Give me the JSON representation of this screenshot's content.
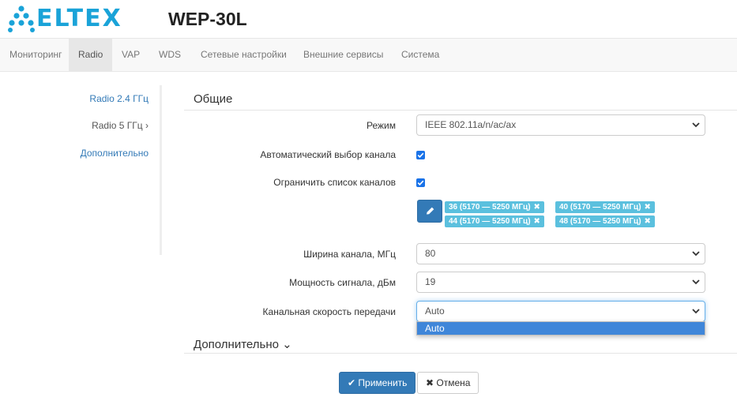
{
  "brand": {
    "logo_text": "ELTEX",
    "product": "WEP-30L",
    "color": "#1aa3d8"
  },
  "nav": {
    "items": [
      {
        "label": "Мониторинг"
      },
      {
        "label": "Radio",
        "active": true
      },
      {
        "label": "VAP"
      },
      {
        "label": "WDS"
      },
      {
        "label": "Сетевые настройки"
      },
      {
        "label": "Внешние сервисы"
      },
      {
        "label": "Система"
      }
    ]
  },
  "sidebar": {
    "items": [
      {
        "label": "Radio 2.4 ГГц"
      },
      {
        "label": "Radio 5 ГГц ›",
        "selected": true
      },
      {
        "label": "Дополнительно"
      }
    ]
  },
  "general": {
    "title": "Общие",
    "mode_label": "Режим",
    "mode_value": "IEEE 802.11a/n/ac/ax",
    "auto_channel_label": "Автоматический выбор канала",
    "auto_channel_checked": true,
    "limit_channels_label": "Ограничить список каналов",
    "limit_channels_checked": true,
    "channel_tags": [
      "36 (5170 — 5250 МГц)",
      "40 (5170 — 5250 МГц)",
      "44 (5170 — 5250 МГц)",
      "48 (5170 — 5250 МГц)"
    ],
    "width_label": "Ширина канала, МГц",
    "width_value": "80",
    "power_label": "Мощность сигнала, дБм",
    "power_value": "19",
    "rate_label": "Канальная скорость передачи",
    "rate_value": "Auto",
    "rate_options": [
      "Auto"
    ]
  },
  "advanced": {
    "title": "Дополнительно ⌄"
  },
  "actions": {
    "apply_label": "✔ Применить",
    "cancel_label": "✖ Отмена"
  },
  "colors": {
    "primary": "#337ab7",
    "tag": "#5bc0de",
    "checkbox": "#1a73e8"
  },
  "icons": {
    "edit": "pencil-icon",
    "caret": "chevron-down-icon",
    "tag_remove": "close-icon"
  }
}
